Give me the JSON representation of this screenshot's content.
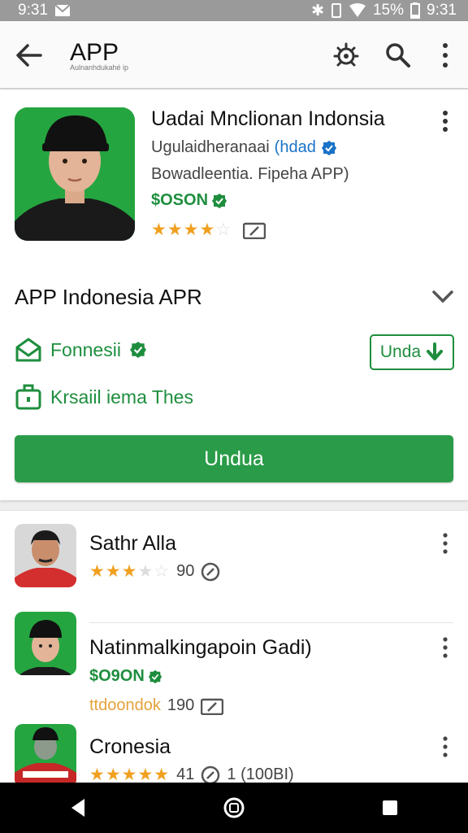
{
  "status_bar": {
    "time_left": "9:31",
    "battery": "15%",
    "time_right": "9:31"
  },
  "app_bar": {
    "title": "APP",
    "subtitle": "Aulnanhdukahé ip",
    "icons": [
      "back-arrow-icon",
      "bug-icon",
      "search-icon",
      "more-vert-icon"
    ]
  },
  "hero": {
    "title": "Uadai Mnclionan Indonsia",
    "developer": "Ugulaidheranaai",
    "developer_tag": "(hdad",
    "category": "Bowadleentia. Fipeha APP)",
    "price": "$OSON",
    "rating": 3.5
  },
  "section": {
    "title": "APP Indonesia APR",
    "feature1": "Fonnesii",
    "feature2": "Krsaiil iema Thes",
    "chip_label": "Unda",
    "button_label": "Undua"
  },
  "list": [
    {
      "name": "Sathr Alla",
      "rating": 3.5,
      "count": "90"
    },
    {
      "name": "Natinmalkingapoin Gadi)",
      "price": "$O9ON",
      "tag": "ttdoondok",
      "count": "190"
    },
    {
      "name": "Cronesia",
      "rating": 5,
      "count": "41",
      "extra": "1 (100BI)"
    }
  ],
  "colors": {
    "accent_green": "#2a9b48",
    "link_blue": "#1a73c8",
    "star": "#f0a020"
  }
}
